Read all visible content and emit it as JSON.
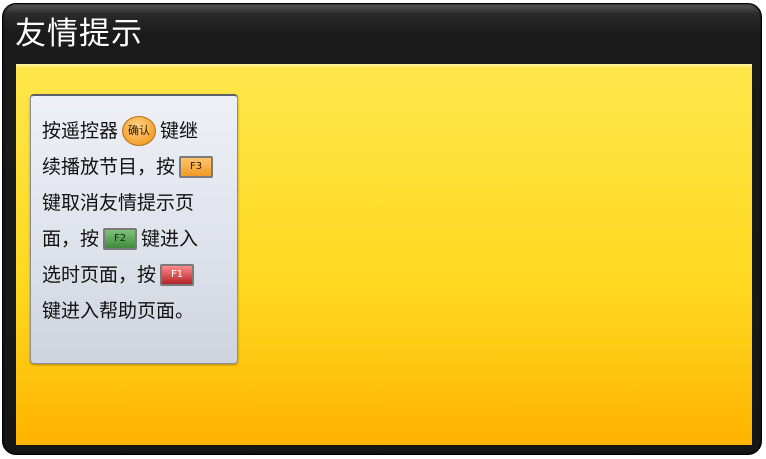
{
  "window": {
    "title": "友情提示"
  },
  "message": {
    "line1": {
      "before": "按遥控器",
      "after": "键继"
    },
    "confirm_button_label": "确认",
    "line2": {
      "before": "续播放节目，按"
    },
    "f3_label": "F3",
    "line3": {
      "text": "键取消友情提示页"
    },
    "line4": {
      "before": "面，按",
      "after": "键进入"
    },
    "f2_label": "F2",
    "line5": {
      "before": "选时页面，按"
    },
    "f1_label": "F1",
    "line6": {
      "text": "键进入帮助页面。"
    }
  },
  "colors": {
    "frame": "#1b1b1b",
    "content_top": "#ffe64a",
    "content_bottom": "#ffb300",
    "confirm_button": "#f4a22e",
    "f3_key": "#f09a26",
    "f2_key": "#3f8a3c",
    "f1_key": "#b4232a"
  }
}
